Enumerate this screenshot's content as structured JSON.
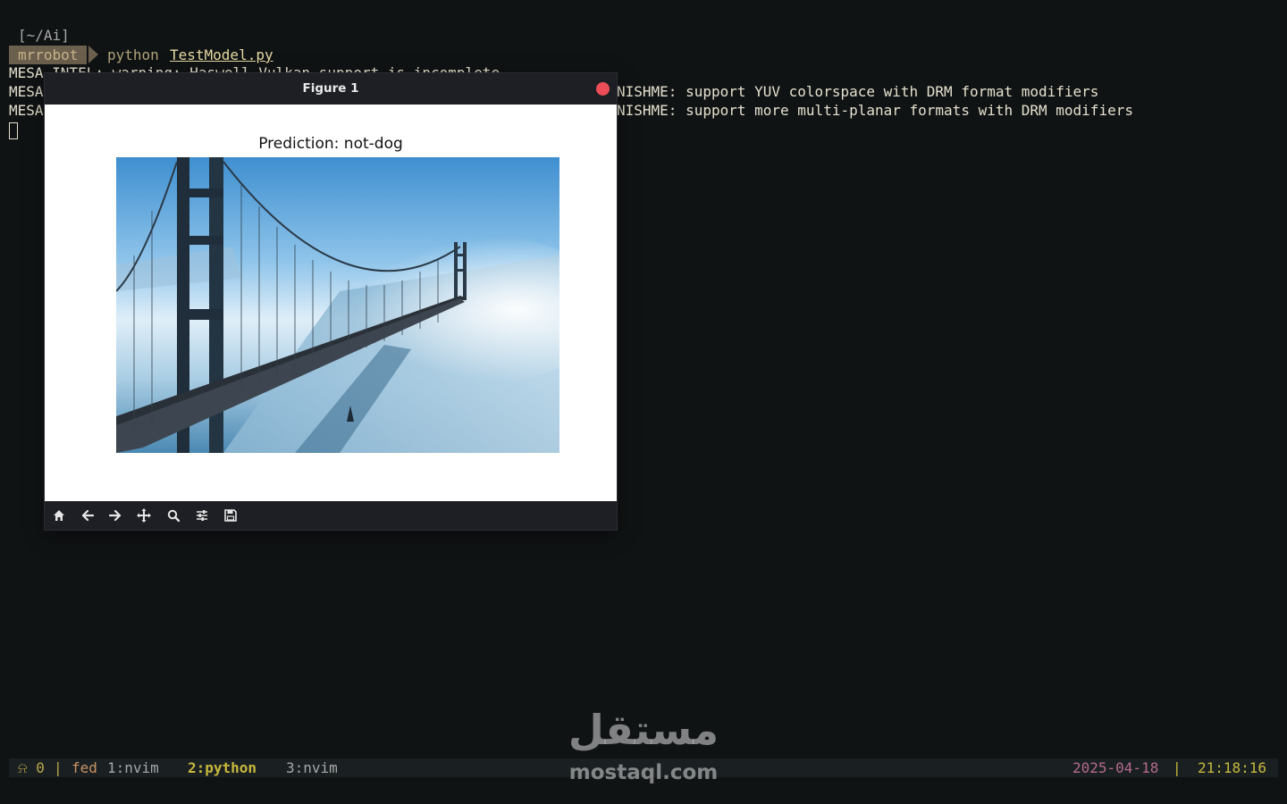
{
  "terminal": {
    "cwd": "[~/Ai]",
    "prompt_user": "mrrobot",
    "command": "python",
    "command_arg": "TestModel.py",
    "lines": [
      "MESA-INTEL: warning: Haswell Vulkan support is incomplete",
      "MESA",
      "MESA"
    ],
    "right_lines": [
      "NISHME: support YUV colorspace with DRM format modifiers",
      "NISHME: support more multi-planar formats with DRM modifiers"
    ]
  },
  "figure": {
    "window_title": "Figure 1",
    "plot_title": "Prediction: not-dog",
    "image_subject": "Golden Gate Bridge in fog",
    "toolbar": [
      "home-icon",
      "back-icon",
      "forward-icon",
      "pan-icon",
      "zoom-icon",
      "configure-subplots-icon",
      "save-icon"
    ]
  },
  "statusbar": {
    "bell": "⍾ 0",
    "separator": "|",
    "session": "fed",
    "windows": [
      {
        "label": "1:nvim",
        "active": false
      },
      {
        "label": "2:python",
        "active": true
      },
      {
        "label": "3:nvim",
        "active": false
      }
    ],
    "date": "2025-04-18",
    "time": "21:18:16"
  },
  "watermark": {
    "arabic": "مستقل",
    "latin": "mostaql.com"
  },
  "colors": {
    "background": "#101314",
    "close_button": "#ec4d57",
    "active_window": "#c7b83c",
    "date": "#b46a8d",
    "time": "#c7b83c"
  }
}
